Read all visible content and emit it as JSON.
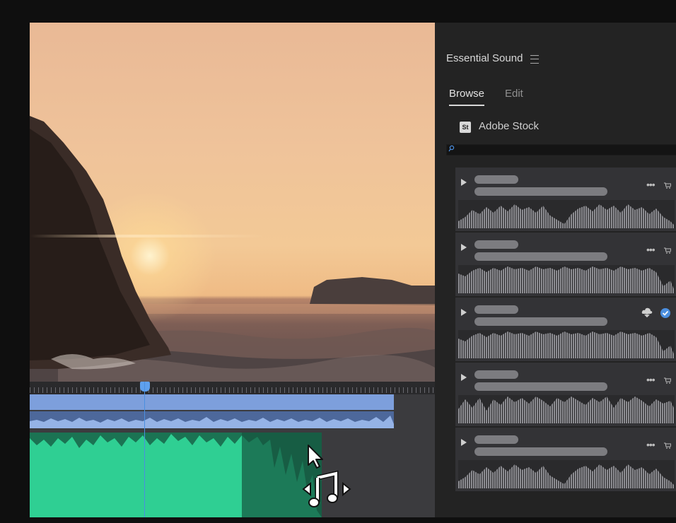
{
  "panel": {
    "title": "Essential Sound",
    "tabs": [
      {
        "label": "Browse",
        "active": true
      },
      {
        "label": "Edit",
        "active": false
      }
    ],
    "source": {
      "badge": "St",
      "label": "Adobe Stock"
    },
    "search": {
      "value": "",
      "placeholder": ""
    },
    "results": [
      {
        "status": "purchase"
      },
      {
        "status": "purchase"
      },
      {
        "status": "licensed"
      },
      {
        "status": "purchase"
      },
      {
        "status": "purchase"
      }
    ]
  },
  "icons": {
    "menu": "hamburger-menu-icon",
    "search": "search-icon",
    "play": "play-icon",
    "more": "more-icon",
    "cart": "cart-icon",
    "download": "cloud-download-icon",
    "licensed": "check-circle-icon",
    "cursor": "arrow-cursor-icon",
    "drag": "music-drag-icon"
  },
  "colors": {
    "accent": "#4b8fe0",
    "video_clip": "#7d9fdc",
    "audio_clip": "#4d689b",
    "music_clip": "#2fcf93",
    "panel_bg": "#232323"
  }
}
